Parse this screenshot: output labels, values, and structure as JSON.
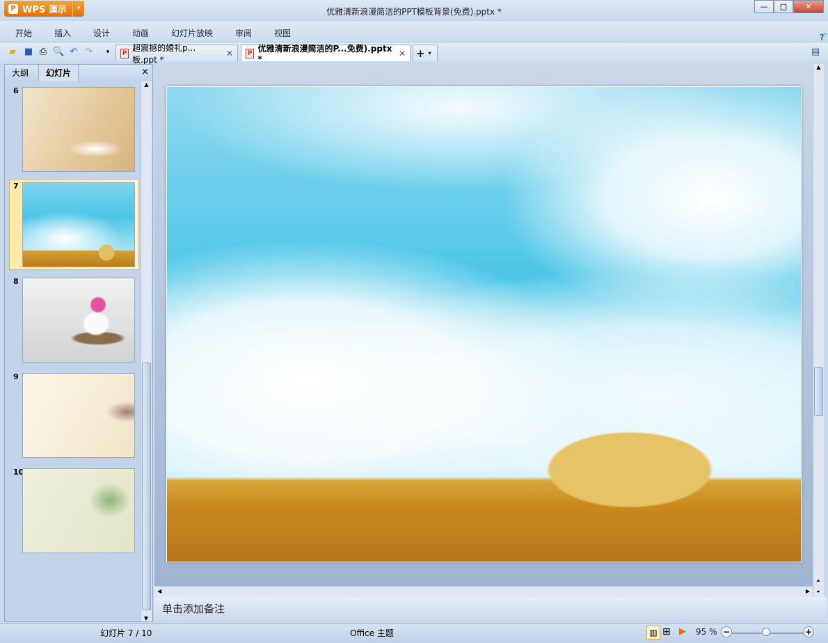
{
  "app": {
    "name": "WPS 演示",
    "title": "优雅清新浪漫简洁的PPT模板背景(免费).pptx *"
  },
  "window_buttons": {
    "minimize": "—",
    "maximize": "□",
    "close": "✕"
  },
  "menu": [
    "开始",
    "插入",
    "设计",
    "动画",
    "幻灯片放映",
    "审阅",
    "视图"
  ],
  "tabs": [
    {
      "label": "超震撼的婚礼p...板.ppt *",
      "active": false
    },
    {
      "label": "优雅清新浪漫简洁的P...免费).pptx *",
      "active": true
    }
  ],
  "new_tab": "+",
  "panel": {
    "tabs": [
      "大纲",
      "幻灯片"
    ],
    "active_tab": "幻灯片",
    "close": "×"
  },
  "slides": [
    {
      "num": "6"
    },
    {
      "num": "7",
      "selected": true
    },
    {
      "num": "8"
    },
    {
      "num": "9"
    },
    {
      "num": "10"
    }
  ],
  "notes_placeholder": "单击添加备注",
  "status": {
    "slide_info": "幻灯片 7 / 10",
    "theme": "Office 主题",
    "zoom": "95 %",
    "zoom_percent": 95
  }
}
